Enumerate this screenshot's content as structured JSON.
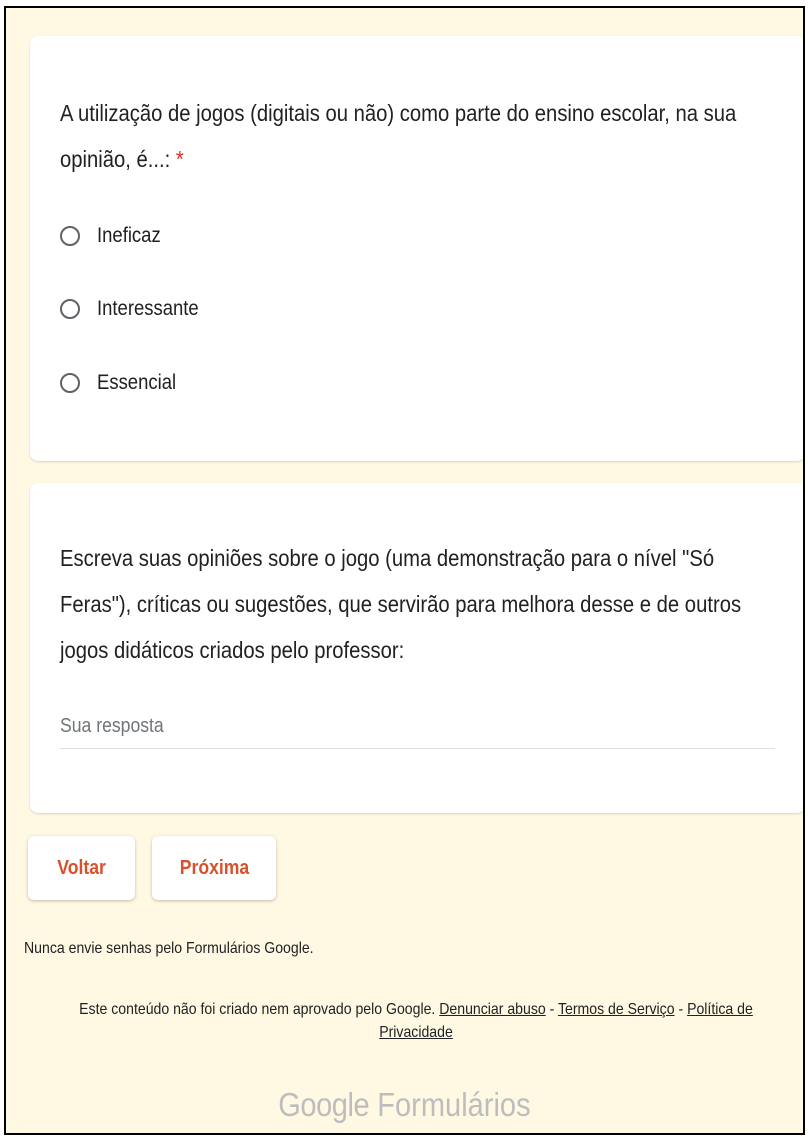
{
  "question1": {
    "title": "A utilização de jogos (digitais ou não) como parte do ensino escolar, na sua opinião, é...:",
    "required_mark": "*",
    "options": [
      "Ineficaz",
      "Interessante",
      "Essencial"
    ]
  },
  "question2": {
    "title": "Escreva suas opiniões sobre o jogo (uma demonstração para o nível \"Só Feras\"), críticas ou sugestões, que servirão para melhora desse e de outros jogos didáticos criados pelo professor:",
    "placeholder": "Sua resposta"
  },
  "navigation": {
    "back_label": "Voltar",
    "next_label": "Próxima"
  },
  "footer": {
    "warning": "Nunca envie senhas pelo Formulários Google.",
    "disclaimer": "Este conteúdo não foi criado nem aprovado pelo Google.",
    "report_link": "Denunciar abuso",
    "separator": "-",
    "terms_link": "Termos de Serviço",
    "privacy_link": "Política de Privacidade",
    "brand_google": "Google",
    "brand_product": "Formulários"
  },
  "colors": {
    "page_background": "#fff9e3",
    "accent": "#d9512c",
    "required": "#d93025"
  },
  "icons": {
    "radio": "radio-unchecked-icon"
  }
}
